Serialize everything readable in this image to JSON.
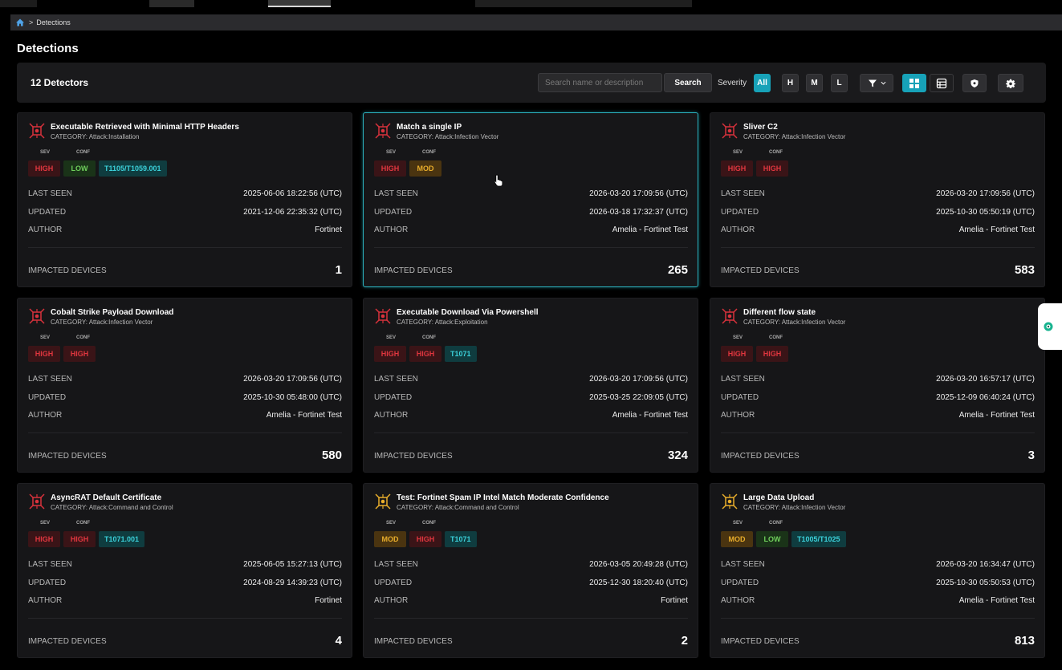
{
  "breadcrumb": {
    "separator": ">",
    "current": "Detections"
  },
  "page": {
    "title": "Detections"
  },
  "toolbar": {
    "count_label": "12 Detectors",
    "search_placeholder": "Search name or description",
    "search_label": "Search",
    "severity_label": "Severity",
    "severity_options": [
      "All",
      "H",
      "M",
      "L"
    ],
    "selected_severity": "All",
    "view_mode": "grid"
  },
  "labels": {
    "sev": "SEV",
    "conf": "CONF",
    "last_seen": "LAST SEEN",
    "updated": "UPDATED",
    "author": "AUTHOR",
    "impacted_devices": "IMPACTED DEVICES"
  },
  "colors": {
    "accent": "#17a2b8",
    "high": "#e0363f",
    "mod": "#e8ad2b",
    "low": "#6fcf5b",
    "mitre": "#3bd0d9"
  },
  "detectors": [
    {
      "title": "Executable Retrieved with Minimal HTTP Headers",
      "category": "CATEGORY: Attack:Installation",
      "sev": "HIGH",
      "conf": "LOW",
      "mitre": "T1105/T1059.001",
      "last_seen": "2025-06-06 18:22:56 (UTC)",
      "updated": "2021-12-06 22:35:32 (UTC)",
      "author": "Fortinet",
      "impacted": "1",
      "icon_color": "red"
    },
    {
      "title": "Match a single IP",
      "category": "CATEGORY: Attack:Infection Vector",
      "sev": "HIGH",
      "conf": "MOD",
      "mitre": "",
      "last_seen": "2026-03-20 17:09:56 (UTC)",
      "updated": "2026-03-18 17:32:37 (UTC)",
      "author": "Amelia - Fortinet Test",
      "impacted": "265",
      "icon_color": "red"
    },
    {
      "title": "Sliver C2",
      "category": "CATEGORY: Attack:Infection Vector",
      "sev": "HIGH",
      "conf": "HIGH",
      "mitre": "",
      "last_seen": "2026-03-20 17:09:56 (UTC)",
      "updated": "2025-10-30 05:50:19 (UTC)",
      "author": "Amelia - Fortinet Test",
      "impacted": "583",
      "icon_color": "red"
    },
    {
      "title": "Cobalt Strike Payload Download",
      "category": "CATEGORY: Attack:Infection Vector",
      "sev": "HIGH",
      "conf": "HIGH",
      "mitre": "",
      "last_seen": "2026-03-20 17:09:56 (UTC)",
      "updated": "2025-10-30 05:48:00 (UTC)",
      "author": "Amelia - Fortinet Test",
      "impacted": "580",
      "icon_color": "red"
    },
    {
      "title": "Executable Download Via Powershell",
      "category": "CATEGORY: Attack:Exploitation",
      "sev": "HIGH",
      "conf": "HIGH",
      "mitre": "T1071",
      "last_seen": "2026-03-20 17:09:56 (UTC)",
      "updated": "2025-03-25 22:09:05 (UTC)",
      "author": "Amelia - Fortinet Test",
      "impacted": "324",
      "icon_color": "red"
    },
    {
      "title": "Different flow state",
      "category": "CATEGORY: Attack:Infection Vector",
      "sev": "HIGH",
      "conf": "HIGH",
      "mitre": "",
      "last_seen": "2026-03-20 16:57:17 (UTC)",
      "updated": "2025-12-09 06:40:24 (UTC)",
      "author": "Amelia - Fortinet Test",
      "impacted": "3",
      "icon_color": "red"
    },
    {
      "title": "AsyncRAT Default Certificate",
      "category": "CATEGORY: Attack:Command and Control",
      "sev": "HIGH",
      "conf": "HIGH",
      "mitre": "T1071.001",
      "last_seen": "2025-06-05 15:27:13 (UTC)",
      "updated": "2024-08-29 14:39:23 (UTC)",
      "author": "Fortinet",
      "impacted": "4",
      "icon_color": "red"
    },
    {
      "title": "Test: Fortinet Spam IP Intel Match Moderate Confidence",
      "category": "CATEGORY: Attack:Command and Control",
      "sev": "MOD",
      "conf": "HIGH",
      "mitre": "T1071",
      "last_seen": "2026-03-05 20:49:28 (UTC)",
      "updated": "2025-12-30 18:20:40 (UTC)",
      "author": "Fortinet",
      "impacted": "2",
      "icon_color": "yellow"
    },
    {
      "title": "Large Data Upload",
      "category": "CATEGORY: Attack:Infection Vector",
      "sev": "MOD",
      "conf": "LOW",
      "mitre": "T1005/T1025",
      "last_seen": "2026-03-20 16:34:47 (UTC)",
      "updated": "2025-10-30 05:50:53 (UTC)",
      "author": "Amelia - Fortinet Test",
      "impacted": "813",
      "icon_color": "yellow"
    }
  ]
}
